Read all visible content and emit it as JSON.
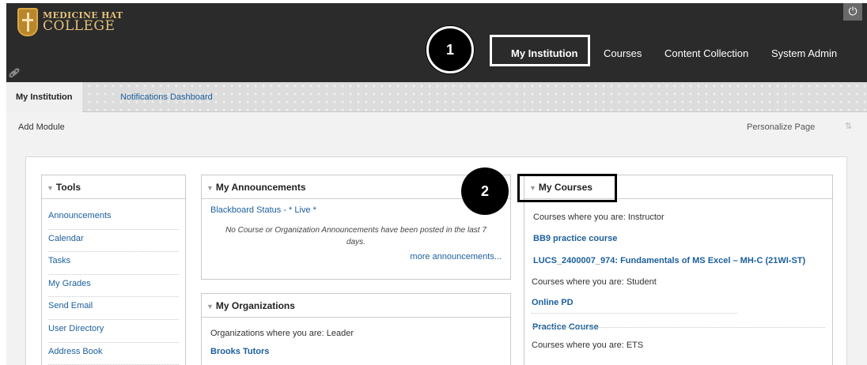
{
  "header": {
    "logo": {
      "line1": "MEDICINE HAT",
      "line2": "COLLEGE"
    },
    "tabs": [
      {
        "label": "My Institution",
        "active": true
      },
      {
        "label": "Courses"
      },
      {
        "label": "Content Collection"
      },
      {
        "label": "System Admin"
      }
    ],
    "link_glyph": "🔗"
  },
  "callouts": [
    "1",
    "2"
  ],
  "subnav": {
    "active": "My Institution",
    "link": "Notifications Dashboard"
  },
  "toolbar": {
    "add_module": "Add Module",
    "personalize": "Personalize Page"
  },
  "tools": {
    "title": "Tools",
    "items": [
      "Announcements",
      "Calendar",
      "Tasks",
      "My Grades",
      "Send Email",
      "User Directory",
      "Address Book"
    ]
  },
  "announcements": {
    "title": "My Announcements",
    "status_link": "Blackboard Status - * Live *",
    "empty_line1": "No Course or Organization Announcements have been posted in the last 7",
    "empty_line2": "days.",
    "more": "more announcements..."
  },
  "organizations": {
    "title": "My Organizations",
    "role_line": "Organizations where you are: Leader",
    "first_org": "Brooks Tutors"
  },
  "courses": {
    "title": "My Courses",
    "instructor_line": "Courses where you are: Instructor",
    "instructor_courses": [
      "BB9 practice course",
      "LUCS_2400007_974: Fundamentals of MS Excel – MH-C (21WI-ST)"
    ],
    "student_line": "Courses where you are: Student",
    "student_courses": [
      "Online PD",
      "Practice Course"
    ],
    "ets_line": "Courses where you are: ETS"
  },
  "colors": {
    "header_bg": "#2b2b2b",
    "link": "#1b5f9c",
    "accent_gold": "#e3c17a"
  }
}
